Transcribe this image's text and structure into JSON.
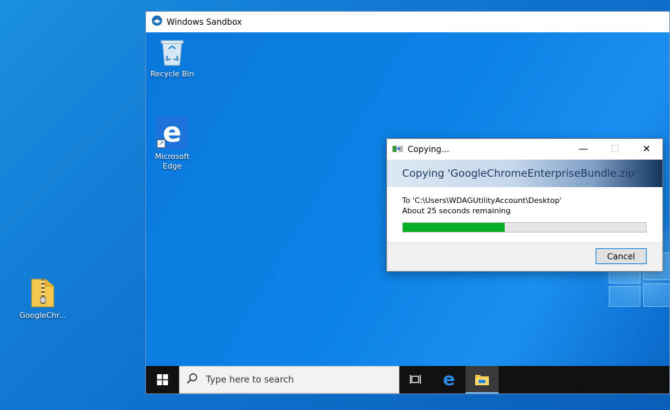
{
  "host_desktop": {
    "zip_file_label": "GoogleChr..."
  },
  "sandbox": {
    "title": "Windows Sandbox",
    "desktop_icons": {
      "recycle_bin": "Recycle Bin",
      "edge_line1": "Microsoft",
      "edge_line2": "Edge"
    }
  },
  "taskbar": {
    "search_placeholder": "Type here to search"
  },
  "copy_dialog": {
    "title": "Copying...",
    "heading": "Copying 'GoogleChromeEnterpriseBundle.zip'",
    "destination": "To 'C:\\Users\\WDAGUtilityAccount\\Desktop'",
    "time_remaining": "About 25 seconds remaining",
    "progress_percent": 42,
    "cancel_label": "Cancel",
    "minimize_glyph": "—",
    "maximize_glyph": "☐",
    "close_glyph": "✕"
  },
  "colors": {
    "progress": "#06b025",
    "accent": "#0078d7"
  }
}
